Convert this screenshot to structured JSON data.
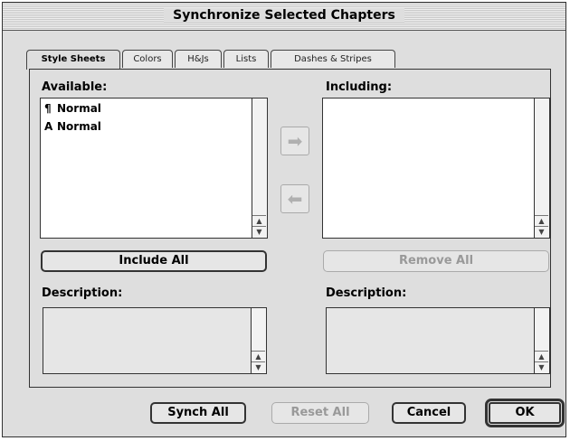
{
  "dialog": {
    "title": "Synchronize Selected Chapters"
  },
  "tabs": [
    {
      "label": "Style Sheets",
      "active": true
    },
    {
      "label": "Colors"
    },
    {
      "label": "H&Js"
    },
    {
      "label": "Lists"
    },
    {
      "label": "Dashes & Stripes"
    }
  ],
  "available": {
    "label": "Available:",
    "items": [
      {
        "icon": "paragraph-icon",
        "glyph": "¶",
        "label": "Normal"
      },
      {
        "icon": "character-style-icon",
        "glyph": "A",
        "label": "Normal"
      }
    ]
  },
  "including": {
    "label": "Including:"
  },
  "buttons": {
    "include_all": "Include All",
    "remove_all": "Remove All",
    "synch_all": "Synch All",
    "reset_all": "Reset All",
    "cancel": "Cancel",
    "ok": "OK"
  },
  "description_left": {
    "label": "Description:"
  },
  "description_right": {
    "label": "Description:"
  },
  "arrows": {
    "right": "➡",
    "left": "⬅"
  }
}
